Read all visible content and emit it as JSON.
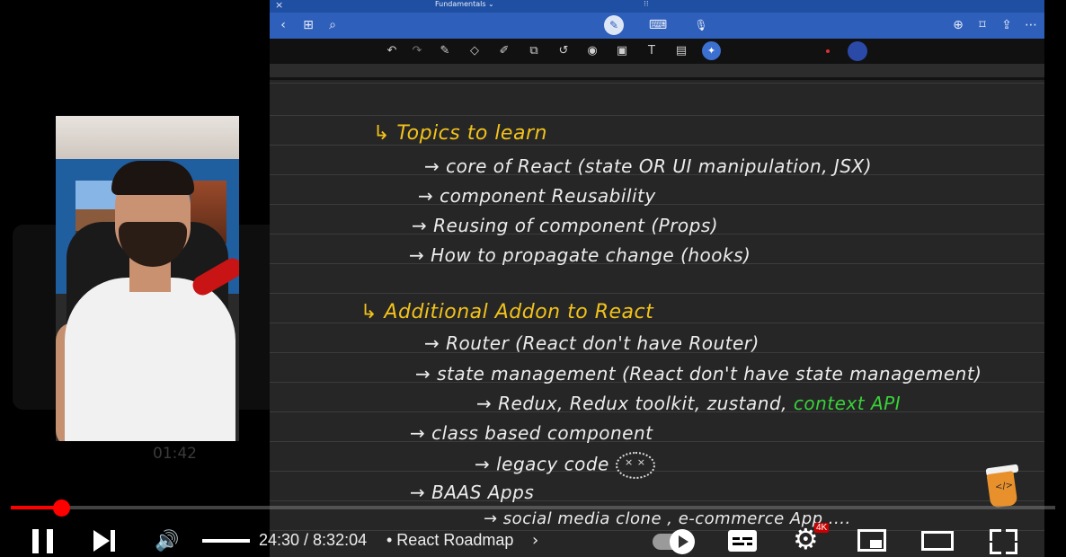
{
  "document": {
    "title": "Fundamentals ⌄"
  },
  "notes": {
    "heading1": "↳ Topics to learn",
    "topics": [
      "→ core of React (state OR UI manipulation, JSX)",
      "→ component Reusability",
      "→ Reusing of component (Props)",
      "→ How to propagate change (hooks)"
    ],
    "heading2": "↳ Additional Addon to React",
    "addon_router": "→ Router (React don't have Router)",
    "addon_state": "→ state management (React don't have state management)",
    "addon_state_libs": "→ Redux, Redux toolkit, zustand,",
    "addon_state_libs_highlight": "context API",
    "addon_class": "→ class based component",
    "addon_legacy": "→ legacy code",
    "addon_legacy_face": "× ×",
    "addon_baas": "→ BAAS Apps",
    "addon_baas_examples": "→ social media clone , e-commerce App ....",
    "sticker_code": "</>"
  },
  "webcam_overlay": {
    "time": "01:42"
  },
  "player": {
    "current_time": "24:30",
    "duration": "8:32:04",
    "time_display": "24:30 / 8:32:04",
    "chapter": "• React Roadmap",
    "chapter_chevron": "›",
    "quality_badge": "4K",
    "progress_fraction": 0.048,
    "volume_fraction": 1.0
  },
  "icons": {
    "close": "×",
    "tb_dots": "⁝⁝",
    "back": "‹",
    "grid": "⊞",
    "search": "⌕",
    "pen_mode": "✎",
    "keyboard": "⌨",
    "mic": "🎙",
    "add_page": "⊕",
    "bookmark": "⌑",
    "share": "⇪",
    "more": "⋯",
    "undo": "↶",
    "redo": "↷",
    "pen": "✎",
    "eraser": "◇",
    "highlighter": "✐",
    "shapes": "⧉",
    "lasso": "↺",
    "laser": "◉",
    "image": "▣",
    "textbox": "T",
    "scan": "▤",
    "lasso_select": "✦",
    "volume": "🔊",
    "settings": "⚙"
  },
  "colors": {
    "toolbar_blue": "#2e5fbb",
    "heading_yellow": "#f2c21b",
    "highlight_green": "#39d13a",
    "progress_red": "#ff0000"
  }
}
